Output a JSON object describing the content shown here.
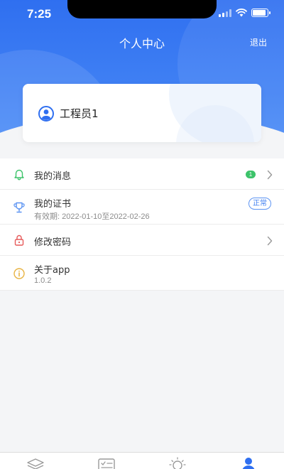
{
  "status_bar": {
    "time": "7:25"
  },
  "nav": {
    "title": "个人中心",
    "logout_label": "退出"
  },
  "profile": {
    "username": "工程员1"
  },
  "menu": {
    "messages": {
      "label": "我的消息",
      "badge": "1"
    },
    "certificate": {
      "label": "我的证书",
      "validity": "有效期: 2022-01-10至2022-02-26",
      "status": "正常"
    },
    "password": {
      "label": "修改密码"
    },
    "about": {
      "label": "关于app",
      "version": "1.0.2"
    }
  },
  "colors": {
    "primary": "#2f6ff0",
    "badge_green": "#3cc36a",
    "status_blue": "#3d7ef0",
    "lock_red": "#e65a5a",
    "info_yellow": "#e8b342"
  },
  "icons": [
    "bell-icon",
    "trophy-icon",
    "lock-icon",
    "info-icon",
    "user-avatar-icon",
    "chevron-right-icon"
  ],
  "tabs": [
    {
      "icon": "layers-icon",
      "active": false
    },
    {
      "icon": "checklist-icon",
      "active": false
    },
    {
      "icon": "bulb-icon",
      "active": false
    },
    {
      "icon": "user-icon",
      "active": true
    }
  ]
}
